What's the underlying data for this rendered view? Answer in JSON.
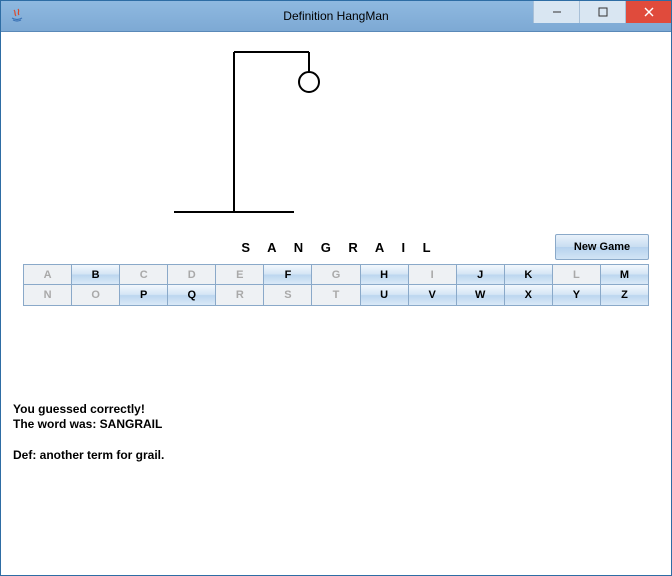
{
  "window": {
    "title": "Definition HangMan"
  },
  "titlebar_controls": {
    "minimize": "–",
    "maximize": "▢",
    "close": "✕"
  },
  "game": {
    "word_spaced": "S A N G R A I L",
    "new_game_label": "New Game"
  },
  "letters_row1": [
    {
      "ch": "A",
      "enabled": false
    },
    {
      "ch": "B",
      "enabled": true
    },
    {
      "ch": "C",
      "enabled": false
    },
    {
      "ch": "D",
      "enabled": false
    },
    {
      "ch": "E",
      "enabled": false
    },
    {
      "ch": "F",
      "enabled": true
    },
    {
      "ch": "G",
      "enabled": false
    },
    {
      "ch": "H",
      "enabled": true
    },
    {
      "ch": "I",
      "enabled": false
    },
    {
      "ch": "J",
      "enabled": true
    },
    {
      "ch": "K",
      "enabled": true
    },
    {
      "ch": "L",
      "enabled": false
    },
    {
      "ch": "M",
      "enabled": true
    }
  ],
  "letters_row2": [
    {
      "ch": "N",
      "enabled": false
    },
    {
      "ch": "O",
      "enabled": false
    },
    {
      "ch": "P",
      "enabled": true
    },
    {
      "ch": "Q",
      "enabled": true
    },
    {
      "ch": "R",
      "enabled": false
    },
    {
      "ch": "S",
      "enabled": false
    },
    {
      "ch": "T",
      "enabled": false
    },
    {
      "ch": "U",
      "enabled": true
    },
    {
      "ch": "V",
      "enabled": true
    },
    {
      "ch": "W",
      "enabled": true
    },
    {
      "ch": "X",
      "enabled": true
    },
    {
      "ch": "Y",
      "enabled": true
    },
    {
      "ch": "Z",
      "enabled": true
    }
  ],
  "messages": {
    "line1": "You guessed correctly!",
    "line2": "The word was: SANGRAIL",
    "definition": "Def: another term for grail."
  },
  "hangman_state": {
    "wrong_guesses": 1,
    "parts_visible": [
      "head"
    ]
  }
}
